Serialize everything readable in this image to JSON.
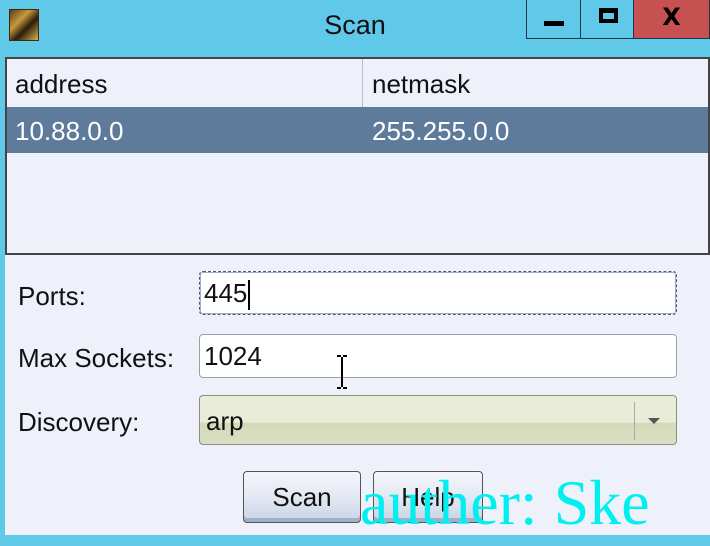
{
  "window": {
    "title": "Scan",
    "close_glyph": "X",
    "icons": [
      "app-icon",
      "minimize-icon",
      "maximize-icon",
      "close-icon"
    ]
  },
  "table": {
    "columns": [
      "address",
      "netmask"
    ],
    "rows": [
      {
        "address": "10.88.0.0",
        "netmask": "255.255.0.0",
        "selected": true
      }
    ],
    "selected_row_color": "#5f7b9c"
  },
  "form": {
    "ports_label": "Ports:",
    "ports_value": "445",
    "max_sockets_label": "Max Sockets:",
    "max_sockets_value": "1024",
    "discovery_label": "Discovery:",
    "discovery_value": "arp"
  },
  "buttons": {
    "scan_label": "Scan",
    "help_label": "Help"
  },
  "watermark": "auther: Ske",
  "colors": {
    "frame": "#60c8e8",
    "close_button": "#c75050",
    "watermark": "#00f0f0"
  }
}
